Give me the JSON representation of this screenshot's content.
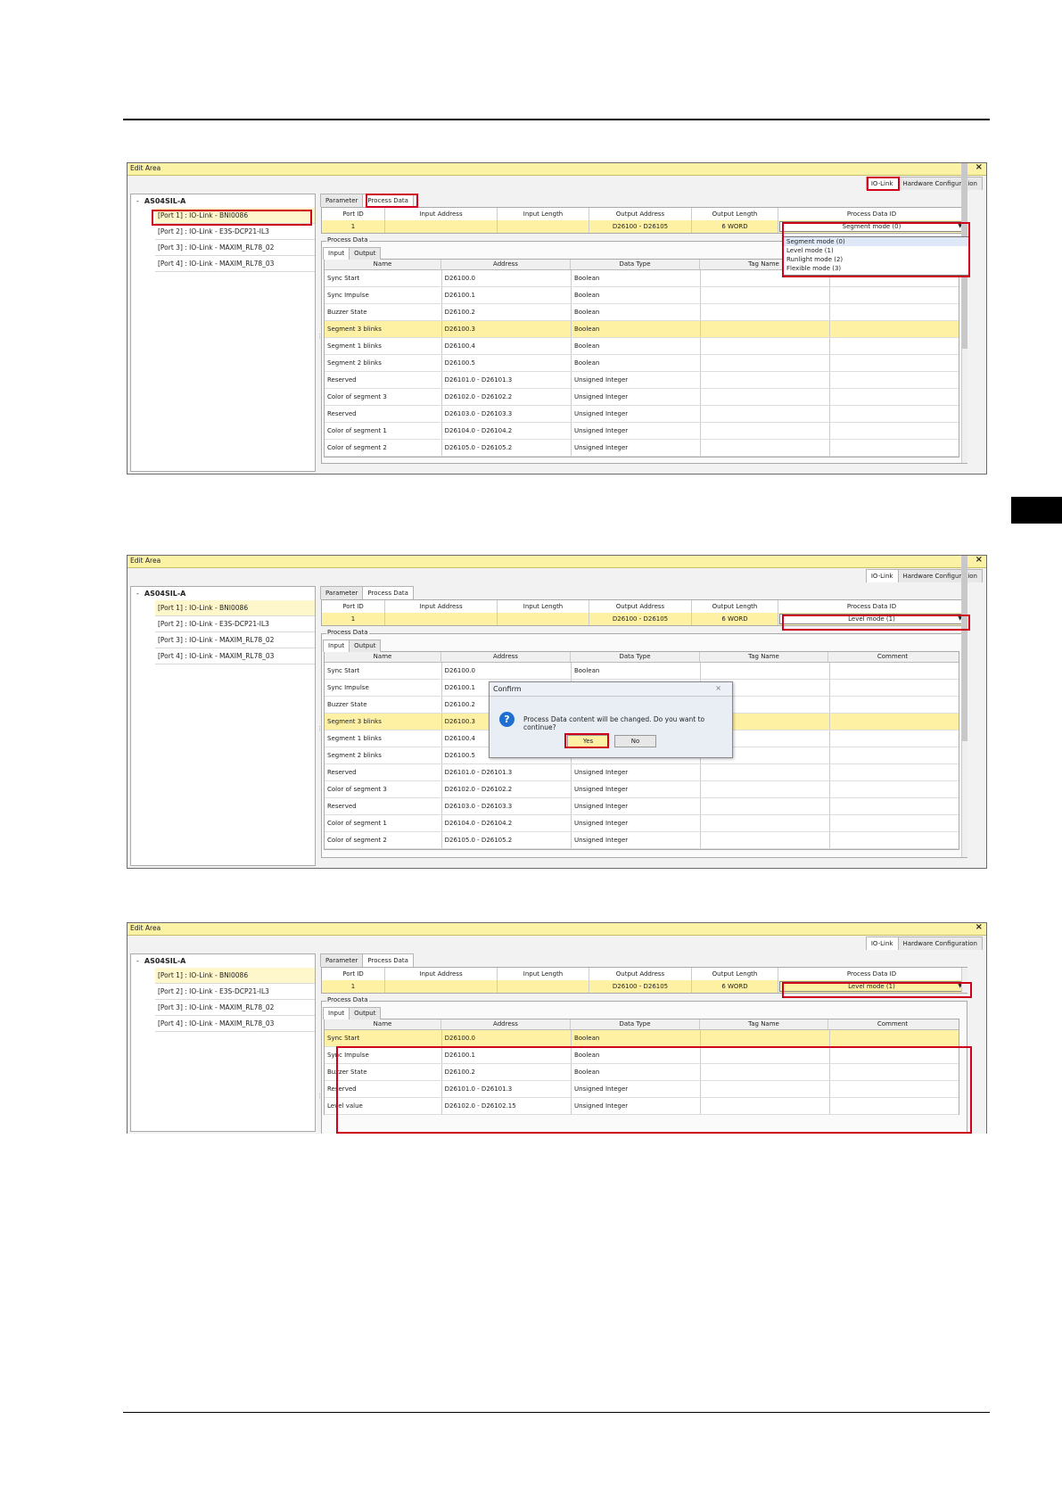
{
  "window": {
    "title": "Edit Area",
    "close_glyph": "×"
  },
  "top_tabs": [
    "IO-Link",
    "Hardware Configuration"
  ],
  "sub_tabs": [
    "Parameter",
    "Process Data"
  ],
  "io_tabs": [
    "Input",
    "Output"
  ],
  "process_data_group": "Process Data",
  "tree": {
    "root": "AS04SIL-A",
    "expander": "-",
    "ports": [
      "[Port 1] : IO-Link - BNI0086",
      "[Port 2] : IO-Link - E3S-DCP21-IL3",
      "[Port 3] : IO-Link - MAXIM_RL78_02",
      "[Port 4] : IO-Link - MAXIM_RL78_03"
    ]
  },
  "port_table": {
    "headers": [
      "Port ID",
      "Input Address",
      "Input Length",
      "Output Address",
      "Output Length",
      "Process Data ID"
    ],
    "row": {
      "port_id": "1",
      "input_address": "",
      "input_length": "",
      "output_address": "D26100 - D26105",
      "output_length": "6 WORD"
    }
  },
  "process_data_id": {
    "screen1": "Segment mode (0)",
    "screen2": "Level mode (1)",
    "screen3": "Level mode (1)",
    "options": [
      "Segment mode (0)",
      "Level mode (1)",
      "Runlight mode (2)",
      "Flexible mode (3)"
    ]
  },
  "data_headers": [
    "Name",
    "Address",
    "Data Type",
    "Tag Name",
    "Comment"
  ],
  "segment_rows": [
    [
      "Sync Start",
      "D26100.0",
      "Boolean"
    ],
    [
      "Sync Impulse",
      "D26100.1",
      "Boolean"
    ],
    [
      "Buzzer State",
      "D26100.2",
      "Boolean"
    ],
    [
      "Segment 3 blinks",
      "D26100.3",
      "Boolean"
    ],
    [
      "Segment 1 blinks",
      "D26100.4",
      "Boolean"
    ],
    [
      "Segment 2 blinks",
      "D26100.5",
      "Boolean"
    ],
    [
      "Reserved",
      "D26101.0 - D26101.3",
      "Unsigned Integer"
    ],
    [
      "Color of segment 3",
      "D26102.0 - D26102.2",
      "Unsigned Integer"
    ],
    [
      "Reserved",
      "D26103.0 - D26103.3",
      "Unsigned Integer"
    ],
    [
      "Color of segment 1",
      "D26104.0 - D26104.2",
      "Unsigned Integer"
    ],
    [
      "Color of segment 2",
      "D26105.0 - D26105.2",
      "Unsigned Integer"
    ]
  ],
  "level_rows": [
    [
      "Sync Start",
      "D26100.0",
      "Boolean"
    ],
    [
      "Sync Impulse",
      "D26100.1",
      "Boolean"
    ],
    [
      "Buzzer State",
      "D26100.2",
      "Boolean"
    ],
    [
      "Reserved",
      "D26101.0 - D26101.3",
      "Unsigned Integer"
    ],
    [
      "Level value",
      "D26102.0 - D26102.15",
      "Unsigned Integer"
    ]
  ],
  "confirm_dialog": {
    "title": "Confirm",
    "close_glyph": "×",
    "icon_glyph": "?",
    "message": "Process Data content will be changed. Do you want to continue?",
    "yes_label": "Yes",
    "no_label": "No"
  },
  "colors": {
    "accent_highlight": "#fff1a4",
    "title_bar": "#fbf2a6",
    "callout": "#d0021b"
  }
}
